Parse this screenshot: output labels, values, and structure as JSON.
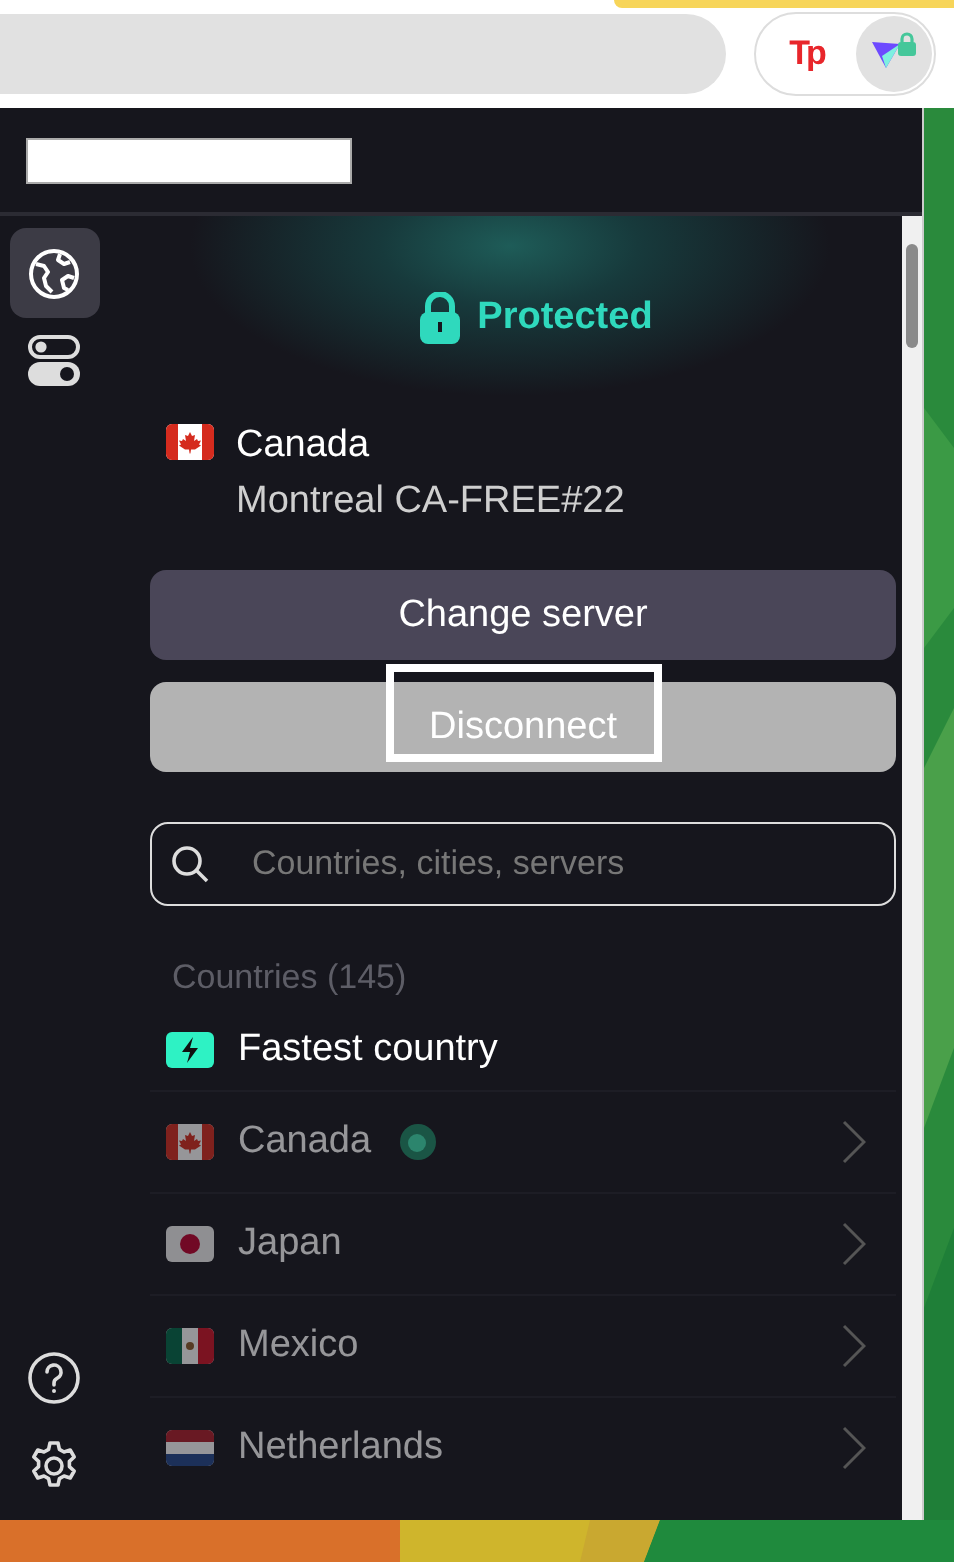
{
  "browser_toolbar": {
    "extensions": [
      {
        "kind": "tp",
        "label": "Tp",
        "selected": false
      },
      {
        "kind": "vpn",
        "selected": true
      }
    ]
  },
  "sidebar": {
    "items": [
      {
        "kind": "globe",
        "selected": true
      },
      {
        "kind": "toggles",
        "selected": false
      }
    ],
    "footer_items": [
      {
        "kind": "help"
      },
      {
        "kind": "settings"
      }
    ]
  },
  "status": {
    "label": "Protected"
  },
  "connection": {
    "flag": {
      "kind": "ca"
    },
    "country": "Canada",
    "server": "Montreal CA-FREE#22"
  },
  "buttons": [
    {
      "label": "Change server",
      "kind": "primary",
      "focused": false
    },
    {
      "label": "Disconnect",
      "kind": "secondary",
      "focused": true
    }
  ],
  "search": {
    "placeholder": "Countries, cities, servers"
  },
  "countries_heading": "Countries (145)",
  "countries": [
    {
      "kind": "fastest",
      "name": "Fastest country",
      "dimmed": false,
      "connected": false
    },
    {
      "kind": "country",
      "flag": {
        "kind": "ca"
      },
      "name": "Canada",
      "dimmed": true,
      "connected": true
    },
    {
      "kind": "country",
      "flag": {
        "kind": "jp"
      },
      "name": "Japan",
      "dimmed": true,
      "connected": false
    },
    {
      "kind": "country",
      "flag": {
        "kind": "mx"
      },
      "name": "Mexico",
      "dimmed": true,
      "connected": false
    },
    {
      "kind": "country",
      "flag": {
        "kind": "nl"
      },
      "name": "Netherlands",
      "dimmed": true,
      "connected": false
    }
  ]
}
